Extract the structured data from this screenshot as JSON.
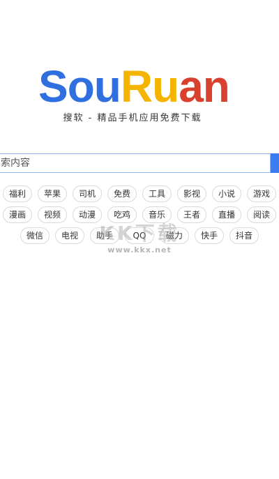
{
  "logo": {
    "letters": [
      {
        "char": "S",
        "color": "#2f6fdf"
      },
      {
        "char": "o",
        "color": "#2f6fdf"
      },
      {
        "char": "u",
        "color": "#2f6fdf"
      },
      {
        "char": "R",
        "color": "#f5b400"
      },
      {
        "char": "u",
        "color": "#f5b400"
      },
      {
        "char": "a",
        "color": "#d9412f"
      },
      {
        "char": "n",
        "color": "#d9412f"
      }
    ]
  },
  "tagline": "搜软 - 精品手机应用免费下载",
  "search": {
    "placeholder": "索内容",
    "button_color": "#3b7df0"
  },
  "tags": {
    "row1": [
      "福利",
      "苹果",
      "司机",
      "免费",
      "工具",
      "影视",
      "小说",
      "游戏"
    ],
    "row2": [
      "漫画",
      "视频",
      "动漫",
      "吃鸡",
      "音乐",
      "王者",
      "直播",
      "阅读"
    ],
    "row3": [
      "微信",
      "电视",
      "助手",
      "QQ",
      "磁力",
      "快手",
      "抖音"
    ]
  },
  "watermark": {
    "text": "KK下载",
    "url": "www.kkx.net"
  }
}
